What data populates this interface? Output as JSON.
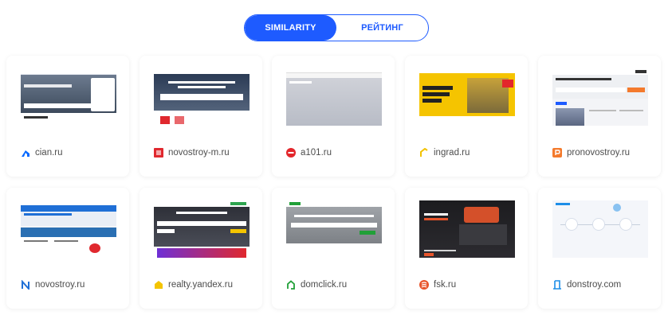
{
  "toggle": {
    "similarity_label": "SIMILARITY",
    "rating_label": "РЕЙТИНГ",
    "active": "similarity"
  },
  "colors": {
    "accent": "#1e5bff"
  },
  "sites": [
    {
      "name": "cian.ru",
      "icon": "cian-logo-icon",
      "color": "#0468ff"
    },
    {
      "name": "novostroy-m.ru",
      "icon": "novostroy-m-logo-icon",
      "color": "#e0282e"
    },
    {
      "name": "a101.ru",
      "icon": "a101-logo-icon",
      "color": "#e3262b"
    },
    {
      "name": "ingrad.ru",
      "icon": "ingrad-logo-icon",
      "color": "#f2c200"
    },
    {
      "name": "pronovostroy.ru",
      "icon": "pronovostroy-logo-icon",
      "color": "#f47a2c"
    },
    {
      "name": "novostroy.ru",
      "icon": "novostroy-logo-icon",
      "color": "#1f6fd6"
    },
    {
      "name": "realty.yandex.ru",
      "icon": "yandex-realty-logo-icon",
      "color": "#f4c400"
    },
    {
      "name": "domclick.ru",
      "icon": "domclick-logo-icon",
      "color": "#21a038"
    },
    {
      "name": "fsk.ru",
      "icon": "fsk-logo-icon",
      "color": "#e8552b"
    },
    {
      "name": "donstroy.com",
      "icon": "donstroy-logo-icon",
      "color": "#1d8ee8"
    }
  ]
}
